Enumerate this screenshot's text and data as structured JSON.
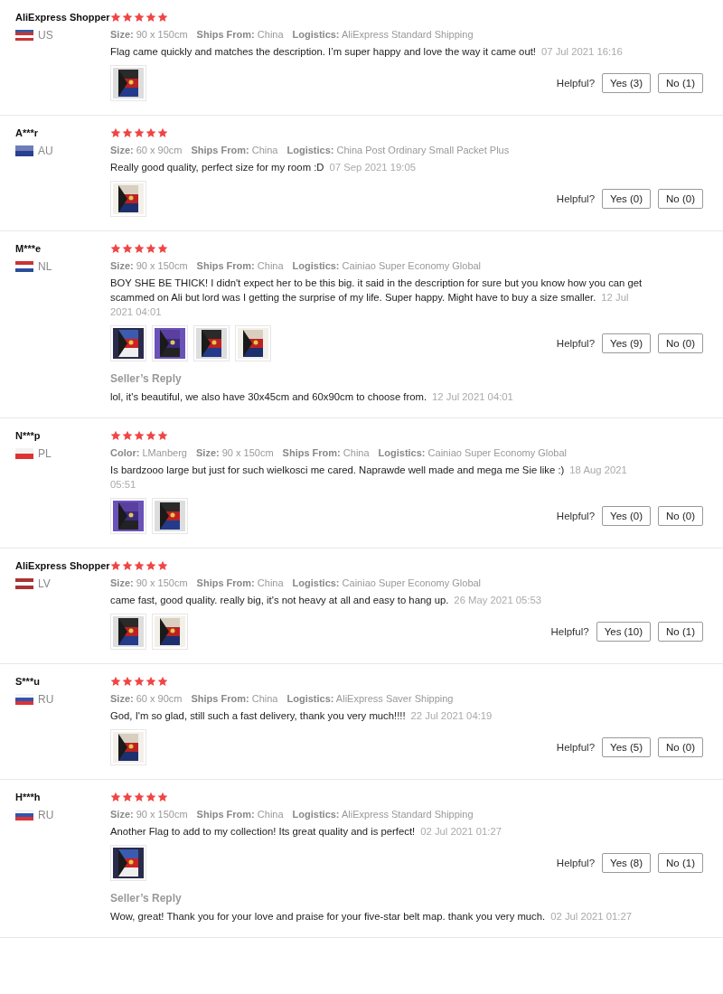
{
  "reviews": [
    {
      "name": "AliExpress Shopper",
      "flag_stripes": [
        {
          "color": "#3c5a9a"
        },
        {
          "color": "#cc3333"
        },
        {
          "color": "#ffffff"
        },
        {
          "color": "#cc3333"
        }
      ],
      "country": "US",
      "stars": 5,
      "attributes": [
        "**Size:** 90 x 150cm",
        "**Ships From:** China",
        "**Logistics:** AliExpress Standard Shipping"
      ],
      "text": "Flag came quickly and matches the description. I’m super happy and love the way it came out!",
      "date": "07 Jul 2021 16:16",
      "photos": [
        {
          "kind": "picture"
        }
      ],
      "helpful": "Helpful?",
      "yes": "Yes (3)",
      "no": "No (1)"
    },
    {
      "name": "A***r",
      "flag_stripes": [
        {
          "color": "#6d7fb8"
        },
        {
          "color": "#2a3f8f"
        }
      ],
      "country": "AU",
      "stars": 5,
      "attributes": [
        "**Size:** 60 x 90cm",
        "**Ships From:** China",
        "**Logistics:** China Post Ordinary Small Packet Plus"
      ],
      "text": "Really good quality, perfect size for my room :D",
      "date": "07 Sep 2021 19:05",
      "photos": [
        {
          "kind": "picture"
        }
      ],
      "helpful": "Helpful?",
      "yes": "Yes (0)",
      "no": "No (0)"
    },
    {
      "name": "M***e",
      "flag_stripes": [
        {
          "color": "#cc3333"
        },
        {
          "color": "#ffffff"
        },
        {
          "color": "#2a4d9a"
        }
      ],
      "country": "NL",
      "stars": 5,
      "attributes": [
        "**Size:** 90 x 150cm",
        "**Ships From:** China",
        "**Logistics:** Cainiao Super Economy Global"
      ],
      "text": "BOY SHE BE THICK! I didn't expect her to be this big. it said in the description for sure but you know how you can get scammed on Ali but lord was I getting the surprise of my life. Super happy. Might have to buy a size smaller.",
      "date": "12 Jul 2021 04:01",
      "photos": [
        {
          "kind": "picture"
        },
        {
          "kind": "picture"
        },
        {
          "kind": "picture"
        },
        {
          "kind": "picture"
        }
      ],
      "helpful": "Helpful?",
      "yes": "Yes (9)",
      "no": "No (0)",
      "seller_reply": {
        "label": "Seller’s Reply",
        "text": "lol, it's beautiful, we also have 30x45cm and 60x90cm to choose from.",
        "date": "12 Jul 2021 04:01"
      }
    },
    {
      "name": "N***p",
      "flag_stripes": [
        {
          "color": "#f2f2f2"
        },
        {
          "color": "#dd3333"
        }
      ],
      "country": "PL",
      "stars": 5,
      "attributes": [
        "**Color:** LManberg",
        "**Size:** 90 x 150cm",
        "**Ships From:** China",
        "**Logistics:** Cainiao Super Economy Global"
      ],
      "text": "Is bardzooo large but just for such wielkosci me cared. Naprawde well made and mega me Sie like :)",
      "date": "18 Aug 2021 05:51",
      "photos": [
        {
          "kind": "picture"
        },
        {
          "kind": "picture"
        }
      ],
      "helpful": "Helpful?",
      "yes": "Yes (0)",
      "no": "No (0)"
    },
    {
      "name": "AliExpress Shopper",
      "flag_stripes": [
        {
          "color": "#aa3333"
        },
        {
          "color": "#ffffff"
        },
        {
          "color": "#aa3333"
        }
      ],
      "country": "LV",
      "stars": 5,
      "attributes": [
        "**Size:** 90 x 150cm",
        "**Ships From:** China",
        "**Logistics:** Cainiao Super Economy Global"
      ],
      "text": "came fast, good quality. really big, it's not heavy at all and easy to hang up.",
      "date": "26 May 2021 05:53",
      "photos": [
        {
          "kind": "picture"
        },
        {
          "kind": "picture"
        }
      ],
      "helpful": "Helpful?",
      "yes": "Yes (10)",
      "no": "No (1)"
    },
    {
      "name": "S***u",
      "flag_stripes": [
        {
          "color": "#f4f4f4"
        },
        {
          "color": "#3055b0"
        },
        {
          "color": "#dd3333"
        }
      ],
      "country": "RU",
      "stars": 5,
      "attributes": [
        "**Size:** 60 x 90cm",
        "**Ships From:** China",
        "**Logistics:** AliExpress Saver Shipping"
      ],
      "text": "God, I'm so glad, still such a fast delivery, thank you very much!!!!",
      "date": "22 Jul 2021 04:19",
      "photos": [
        {
          "kind": "picture"
        }
      ],
      "helpful": "Helpful?",
      "yes": "Yes (5)",
      "no": "No (0)"
    },
    {
      "name": "H***h",
      "flag_stripes": [
        {
          "color": "#f4f4f4"
        },
        {
          "color": "#3055b0"
        },
        {
          "color": "#dd3333"
        }
      ],
      "country": "RU",
      "stars": 5,
      "attributes": [
        "**Size:** 90 x 150cm",
        "**Ships From:** China",
        "**Logistics:** AliExpress Standard Shipping"
      ],
      "text": "Another Flag to add to my collection! Its great quality and is perfect!",
      "date": "02 Jul 2021 01:27",
      "photos": [
        {
          "kind": "picture"
        }
      ],
      "helpful": "Helpful?",
      "yes": "Yes (8)",
      "no": "No (1)",
      "seller_reply": {
        "label": "Seller’s Reply",
        "text": "Wow, great! Thank you for your love and praise for your five-star belt map. thank you very much.",
        "date": "02 Jul 2021 01:27"
      }
    }
  ]
}
